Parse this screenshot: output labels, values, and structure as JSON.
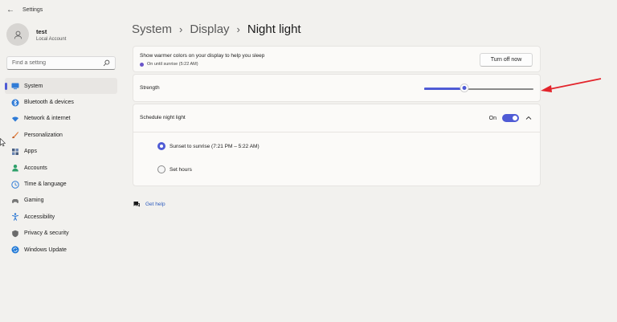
{
  "window": {
    "title": "Settings"
  },
  "profile": {
    "name": "test",
    "account_type": "Local Account"
  },
  "search": {
    "placeholder": "Find a setting"
  },
  "sidebar": {
    "items": [
      {
        "label": "System",
        "icon": "monitor-icon",
        "color": "#2f7bd6",
        "active": true
      },
      {
        "label": "Bluetooth & devices",
        "icon": "bluetooth-icon",
        "color": "#2f7bd6"
      },
      {
        "label": "Network & internet",
        "icon": "wifi-icon",
        "color": "#2f7bd6"
      },
      {
        "label": "Personalization",
        "icon": "brush-icon",
        "color": "#e07b39"
      },
      {
        "label": "Apps",
        "icon": "apps-icon",
        "color": "#4a5f80"
      },
      {
        "label": "Accounts",
        "icon": "person-icon",
        "color": "#2ea06a"
      },
      {
        "label": "Time & language",
        "icon": "globe-clock-icon",
        "color": "#2f7bd6"
      },
      {
        "label": "Gaming",
        "icon": "gamepad-icon",
        "color": "#777777"
      },
      {
        "label": "Accessibility",
        "icon": "accessibility-icon",
        "color": "#1f6fd1"
      },
      {
        "label": "Privacy & security",
        "icon": "shield-icon",
        "color": "#6b6b6b"
      },
      {
        "label": "Windows Update",
        "icon": "update-icon",
        "color": "#1f78d6"
      }
    ]
  },
  "breadcrumb": {
    "items": [
      "System",
      "Display"
    ],
    "current": "Night light"
  },
  "night_light": {
    "description": "Show warmer colors on your display to help you sleep",
    "status": "On until sunrise (5:22 AM)",
    "button_label": "Turn off now"
  },
  "strength": {
    "label": "Strength",
    "value_fraction": 0.37
  },
  "schedule": {
    "label": "Schedule night light",
    "toggle_label": "On",
    "toggle_on": true,
    "options": [
      {
        "label": "Sunset to sunrise (7:21 PM – 5:22 AM)",
        "checked": true
      },
      {
        "label": "Set hours",
        "checked": false
      }
    ]
  },
  "help": {
    "label": "Get help"
  },
  "colors": {
    "accent": "#4f5bd5",
    "annotation_arrow": "#e3242b"
  }
}
